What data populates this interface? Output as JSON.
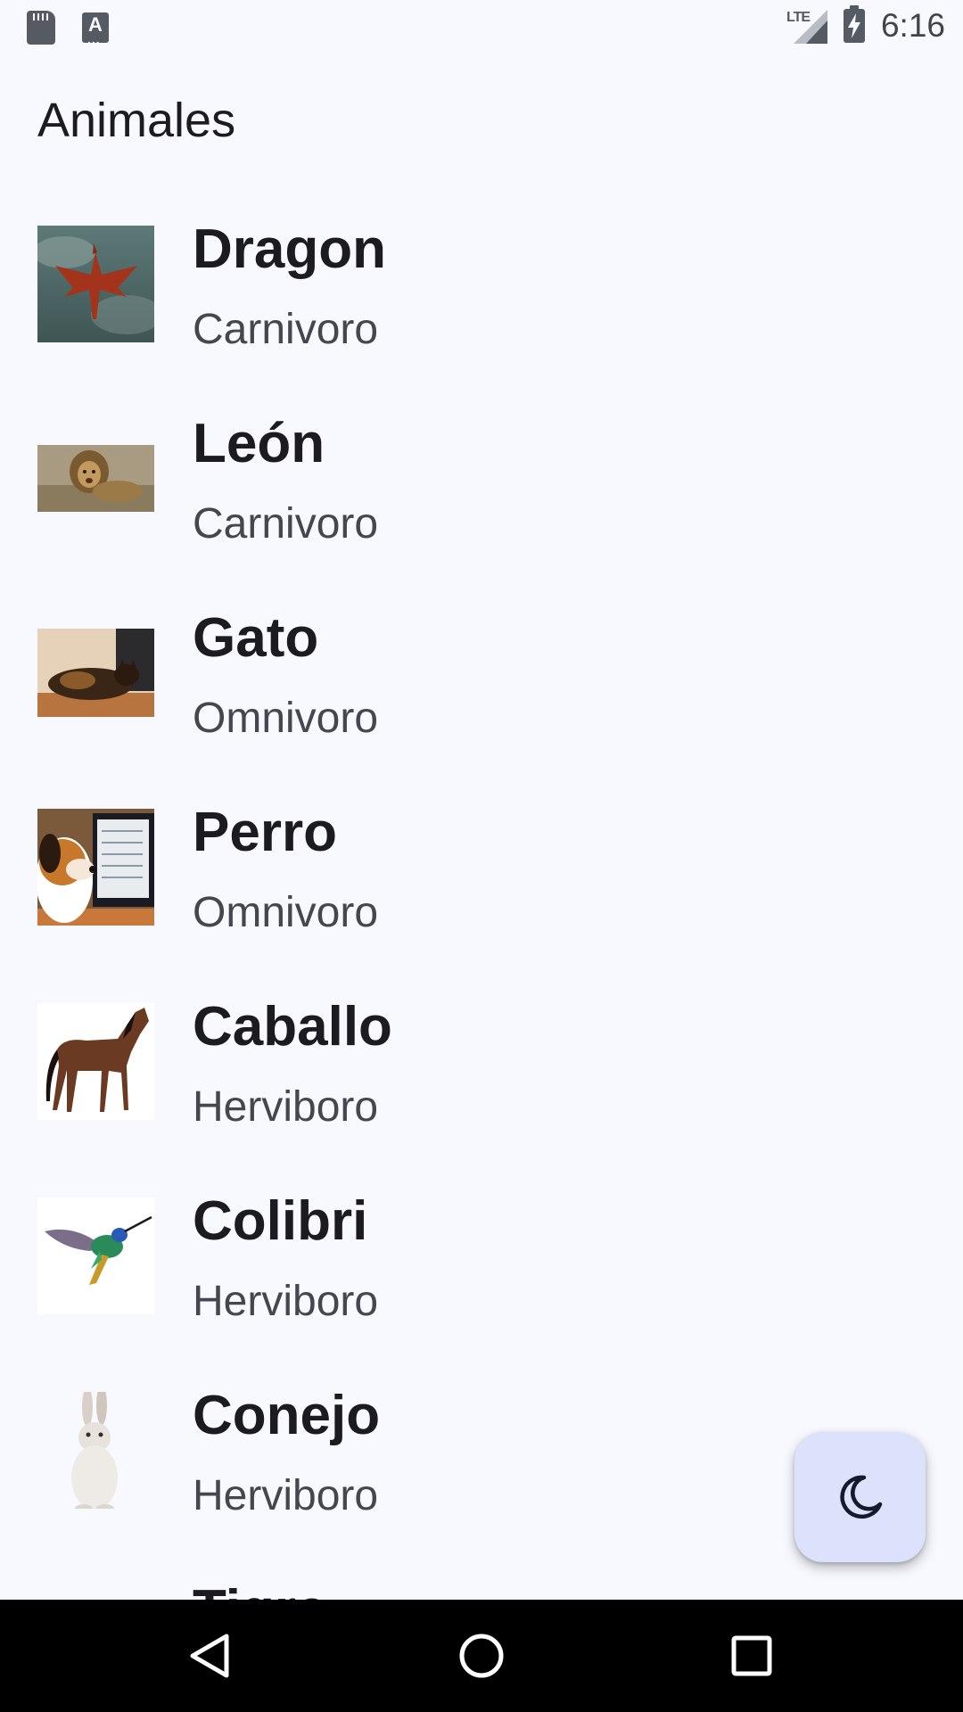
{
  "status_bar": {
    "time": "6:16",
    "network": "LTE"
  },
  "app": {
    "title": "Animales"
  },
  "animals": [
    {
      "name": "Dragon",
      "diet": "Carnivoro",
      "image_icon": "dragon-image"
    },
    {
      "name": "León",
      "diet": "Carnivoro",
      "image_icon": "lion-image"
    },
    {
      "name": "Gato",
      "diet": "Omnivoro",
      "image_icon": "cat-image"
    },
    {
      "name": "Perro",
      "diet": "Omnivoro",
      "image_icon": "dog-image"
    },
    {
      "name": "Caballo",
      "diet": "Herviboro",
      "image_icon": "horse-image"
    },
    {
      "name": "Colibri",
      "diet": "Herviboro",
      "image_icon": "hummingbird-image"
    },
    {
      "name": "Conejo",
      "diet": "Herviboro",
      "image_icon": "rabbit-image"
    },
    {
      "name": "Tigre",
      "diet": "",
      "image_icon": "tiger-image"
    }
  ],
  "fab": {
    "icon": "moon-icon"
  },
  "navigation": {
    "back_icon": "back-triangle-icon",
    "home_icon": "home-circle-icon",
    "recents_icon": "recents-square-icon"
  },
  "colors": {
    "background": "#f8f9ff",
    "fab_background": "#dce2fb",
    "fab_icon": "#141b2c",
    "title_text": "#1b1b21",
    "subtitle_text": "#45464f"
  }
}
